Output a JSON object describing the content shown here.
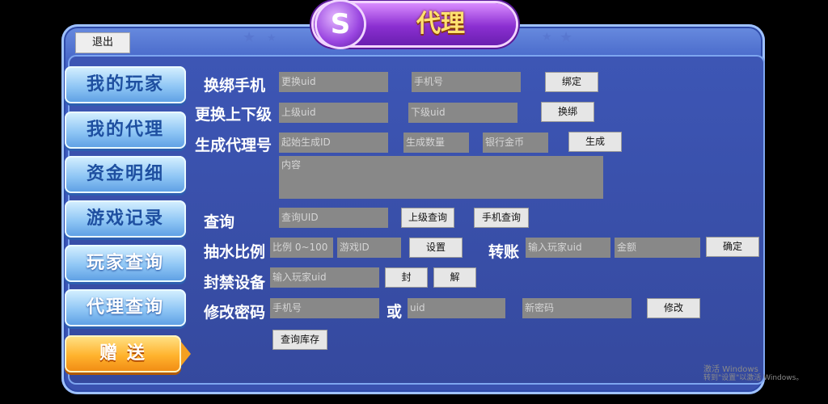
{
  "header": {
    "title": "代理",
    "logo_letter": "S"
  },
  "toolbar": {
    "exit_label": "退出"
  },
  "sidebar": {
    "items": [
      {
        "label": "我的玩家"
      },
      {
        "label": "我的代理"
      },
      {
        "label": "资金明细"
      },
      {
        "label": "游戏记录"
      },
      {
        "label": "玩家查询"
      },
      {
        "label": "代理查询"
      },
      {
        "label": "赠 送"
      }
    ]
  },
  "rebind_phone": {
    "label": "换绑手机",
    "uid_placeholder": "更换uid",
    "phone_placeholder": "手机号",
    "button": "绑定"
  },
  "change_superior": {
    "label": "更换上下级",
    "upper_placeholder": "上级uid",
    "lower_placeholder": "下级uid",
    "button": "换绑"
  },
  "generate_agent": {
    "label": "生成代理号",
    "start_placeholder": "起始生成ID",
    "count_placeholder": "生成数量",
    "coins_placeholder": "银行金币",
    "button": "生成",
    "content_placeholder": "内容"
  },
  "query": {
    "label": "查询",
    "uid_placeholder": "查询UID",
    "upper_button": "上级查询",
    "phone_button": "手机查询"
  },
  "rake": {
    "label": "抽水比例",
    "ratio_placeholder": "比例 0~100",
    "game_placeholder": "游戏ID",
    "button": "设置"
  },
  "transfer": {
    "label": "转账",
    "player_placeholder": "输入玩家uid",
    "amount_placeholder": "金额",
    "button": "确定"
  },
  "ban_device": {
    "label": "封禁设备",
    "player_placeholder": "输入玩家uid",
    "ban_button": "封",
    "unban_button": "解"
  },
  "change_password": {
    "label": "修改密码",
    "phone_placeholder": "手机号",
    "or_label": "或",
    "uid_placeholder": "uid",
    "new_password_placeholder": "新密码",
    "button": "修改"
  },
  "inventory": {
    "button": "查询库存"
  },
  "watermark": {
    "line1": "激活 Windows",
    "line2": "转到\"设置\"以激活 Windows。"
  }
}
